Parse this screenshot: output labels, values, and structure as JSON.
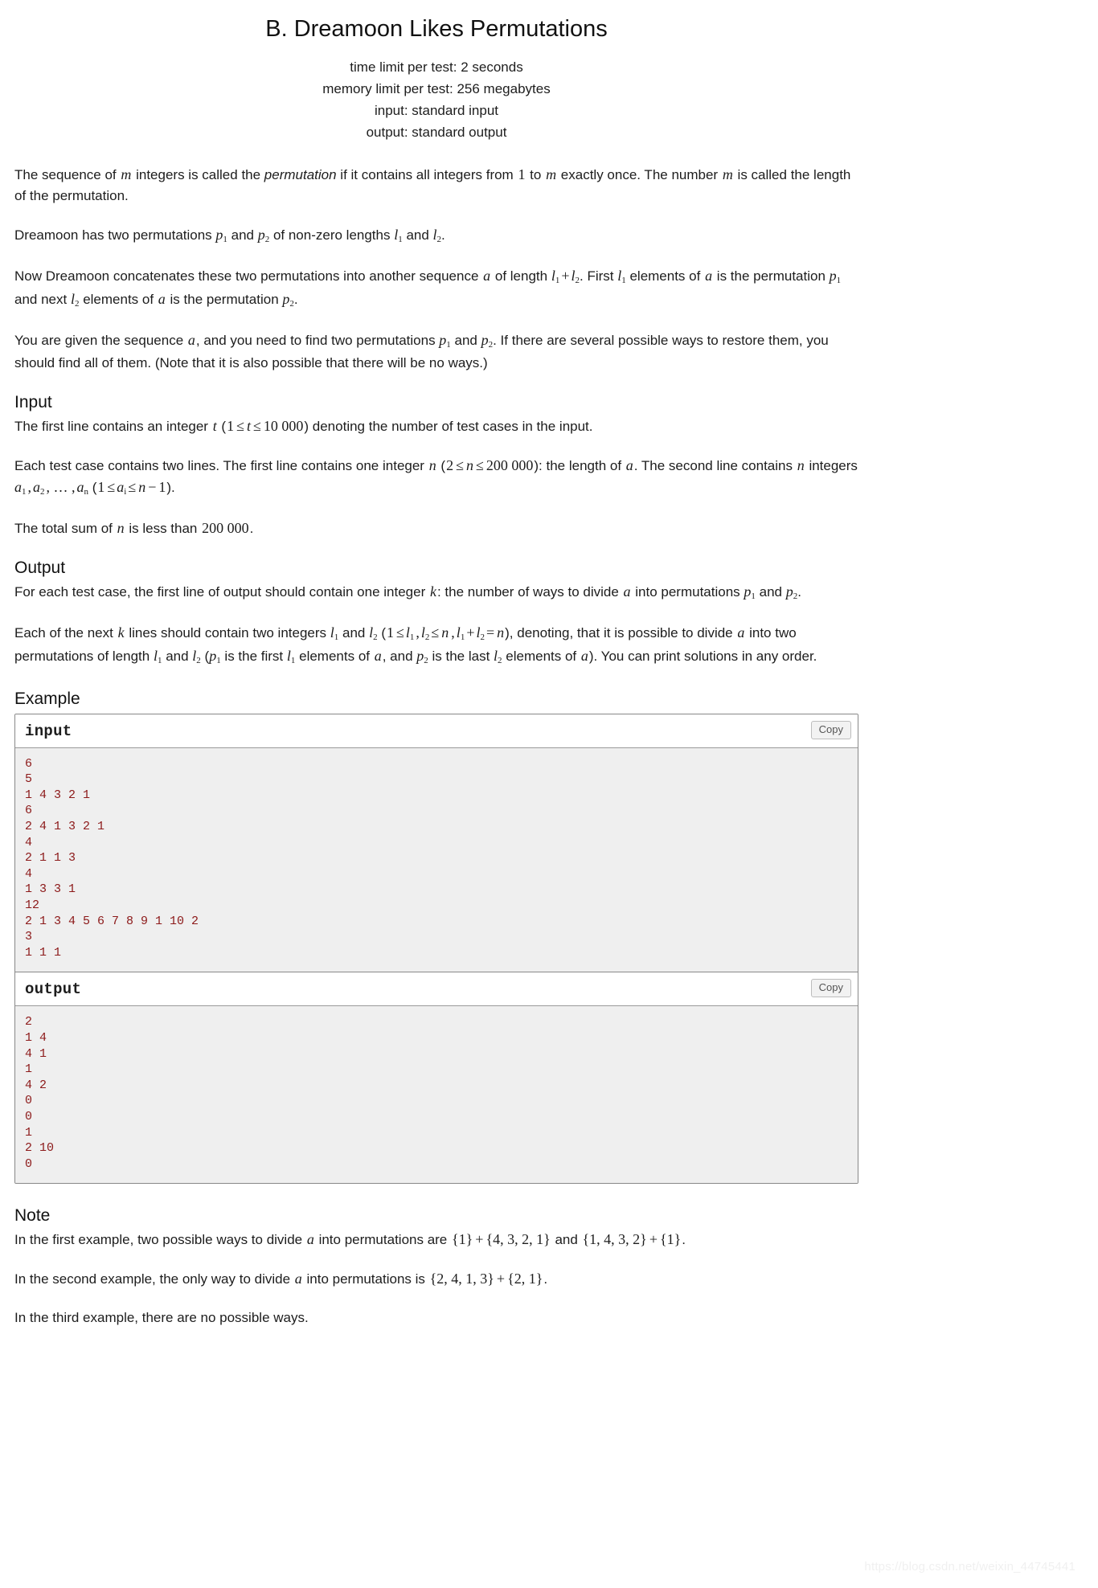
{
  "header": {
    "title": "B. Dreamoon Likes Permutations",
    "time_limit": "time limit per test: 2 seconds",
    "memory_limit": "memory limit per test: 256 megabytes",
    "input_spec": "input: standard input",
    "output_spec": "output: standard output"
  },
  "statement": {
    "p1_a": "The sequence of ",
    "p1_m1": "m",
    "p1_b": " integers is called the ",
    "p1_emph": "permutation",
    "p1_c": " if it contains all integers from ",
    "p1_one": "1",
    "p1_d": " to ",
    "p1_m2": "m",
    "p1_e": " exactly once. The number ",
    "p1_m3": "m",
    "p1_f": " is called the length of the permutation.",
    "p2_a": "Dreamoon has two permutations ",
    "p2_p1": "p",
    "p2_p1sub": "1",
    "p2_b": " and ",
    "p2_p2": "p",
    "p2_p2sub": "2",
    "p2_c": " of non-zero lengths ",
    "p2_l1": "l",
    "p2_l1sub": "1",
    "p2_d": " and ",
    "p2_l2": "l",
    "p2_l2sub": "2",
    "p2_e": ".",
    "p3_a": "Now Dreamoon concatenates these two permutations into another sequence ",
    "p3_a_var": "a",
    "p3_b": " of length ",
    "p3_l1": "l",
    "p3_l1sub": "1",
    "p3_plus": "+",
    "p3_l2": "l",
    "p3_l2sub": "2",
    "p3_c": ". First ",
    "p3_l1b": "l",
    "p3_l1bsub": "1",
    "p3_d": " elements of ",
    "p3_a_var2": "a",
    "p3_e": " is the permutation ",
    "p3_p1": "p",
    "p3_p1sub": "1",
    "p3_f": " and next ",
    "p3_l2b": "l",
    "p3_l2bsub": "2",
    "p3_g": " elements of ",
    "p3_a_var3": "a",
    "p3_h": " is the permutation ",
    "p3_p2": "p",
    "p3_p2sub": "2",
    "p3_i": ".",
    "p4_a": "You are given the sequence ",
    "p4_a_var": "a",
    "p4_b": ", and you need to find two permutations ",
    "p4_p1": "p",
    "p4_p1sub": "1",
    "p4_c": " and ",
    "p4_p2": "p",
    "p4_p2sub": "2",
    "p4_d": ". If there are several possible ways to restore them, you should find all of them. (Note that it is also possible that there will be no ways.)"
  },
  "input_section": {
    "heading": "Input",
    "p1_a": "The first line contains an integer ",
    "p1_t": "t",
    "p1_b": " (",
    "p1_one": "1",
    "p1_le1": "≤",
    "p1_t2": "t",
    "p1_le2": "≤",
    "p1_max": "10 000",
    "p1_c": ") denoting the number of test cases in the input.",
    "p2_a": "Each test case contains two lines. The first line contains one integer ",
    "p2_n": "n",
    "p2_b": " (",
    "p2_two": "2",
    "p2_le1": "≤",
    "p2_n2": "n",
    "p2_le2": "≤",
    "p2_max": "200 000",
    "p2_c": "): the length of ",
    "p2_a_var": "a",
    "p2_d": ". The second line contains ",
    "p2_n3": "n",
    "p2_e": " integers ",
    "p2_a1": "a",
    "p2_a1sub": "1",
    "p2_comma1": ",",
    "p2_a2": "a",
    "p2_a2sub": "2",
    "p2_dots": ", … ,",
    "p2_an": "a",
    "p2_ansub": "n",
    "p2_f": " (",
    "p2_one": "1",
    "p2_le3": "≤",
    "p2_ai": "a",
    "p2_aisub": "i",
    "p2_le4": "≤",
    "p2_n4": "n",
    "p2_minus": "−",
    "p2_oneb": "1",
    "p2_g": ").",
    "p3_a": "The total sum of ",
    "p3_n": "n",
    "p3_b": " is less than ",
    "p3_max": "200 000",
    "p3_c": "."
  },
  "output_section": {
    "heading": "Output",
    "p1_a": "For each test case, the first line of output should contain one integer ",
    "p1_k": "k",
    "p1_b": ": the number of ways to divide ",
    "p1_a_var": "a",
    "p1_c": " into permutations ",
    "p1_p1": "p",
    "p1_p1sub": "1",
    "p1_d": " and ",
    "p1_p2": "p",
    "p1_p2sub": "2",
    "p1_e": ".",
    "p2_a": "Each of the next ",
    "p2_k": "k",
    "p2_b": " lines should contain two integers ",
    "p2_l1": "l",
    "p2_l1sub": "1",
    "p2_c": " and ",
    "p2_l2": "l",
    "p2_l2sub": "2",
    "p2_d": " (",
    "p2_one": "1",
    "p2_le1": "≤",
    "p2_l1b": "l",
    "p2_l1bsub": "1",
    "p2_comma": ",",
    "p2_l2b": "l",
    "p2_l2bsub": "2",
    "p2_le2": "≤",
    "p2_n": "n",
    "p2_comma2": ",",
    "p2_l1c": "l",
    "p2_l1csub": "1",
    "p2_plus": "+",
    "p2_l2c": "l",
    "p2_l2csub": "2",
    "p2_eq": "=",
    "p2_n2": "n",
    "p2_e": "), denoting, that it is possible to divide ",
    "p2_a_var": "a",
    "p2_f": " into two permutations of length ",
    "p2_l1d": "l",
    "p2_l1dsub": "1",
    "p2_g": " and ",
    "p2_l2d": "l",
    "p2_l2dsub": "2",
    "p2_h": " (",
    "p2_p1": "p",
    "p2_p1sub": "1",
    "p2_i": " is the first ",
    "p2_l1e": "l",
    "p2_l1esub": "1",
    "p2_j": " elements of ",
    "p2_a_var2": "a",
    "p2_k2": ", and ",
    "p2_p2": "p",
    "p2_p2sub": "2",
    "p2_l": " is the last ",
    "p2_l2e": "l",
    "p2_l2esub": "2",
    "p2_m": " elements of ",
    "p2_a_var3": "a",
    "p2_n3": "). You can print solutions in any order."
  },
  "example": {
    "heading": "Example",
    "input_label": "input",
    "output_label": "output",
    "copy_label": "Copy",
    "input_data": "6\n5\n1 4 3 2 1\n6\n2 4 1 3 2 1\n4\n2 1 1 3\n4\n1 3 3 1\n12\n2 1 3 4 5 6 7 8 9 1 10 2\n3\n1 1 1",
    "output_data": "2\n1 4\n4 1\n1\n4 2\n0\n0\n1\n2 10\n0"
  },
  "note": {
    "heading": "Note",
    "p1_a": "In the first example, two possible ways to divide ",
    "p1_a_var": "a",
    "p1_b": " into permutations are ",
    "p1_set1": "{1}",
    "p1_plus1": "+",
    "p1_set2": "{4, 3, 2, 1}",
    "p1_c": " and ",
    "p1_set3": "{1, 4, 3, 2}",
    "p1_plus2": "+",
    "p1_set4": "{1}",
    "p1_d": ".",
    "p2_a": "In the second example, the only way to divide ",
    "p2_a_var": "a",
    "p2_b": " into permutations is ",
    "p2_set1": "{2, 4, 1, 3}",
    "p2_plus": "+",
    "p2_set2": "{2, 1}",
    "p2_c": ".",
    "p3": "In the third example, there are no possible ways."
  },
  "watermark": "https://blog.csdn.net/weixin_44745441",
  "colors": {
    "sample_text": "#8c1919",
    "sample_bg": "#efefef",
    "border": "#888888"
  }
}
